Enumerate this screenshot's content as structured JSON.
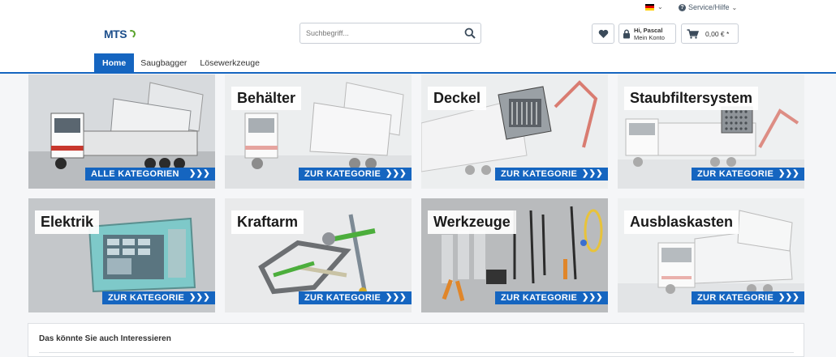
{
  "topbar": {
    "language": {
      "flag_icon": "germany-flag-icon",
      "colors": [
        "#000000",
        "#dd0000",
        "#ffce00"
      ]
    },
    "service_label": "Service/Hilfe"
  },
  "header": {
    "logo_text": "MTS",
    "logo_colors": {
      "text": "#1d4f8c",
      "swoosh": "#5aa32c"
    },
    "search": {
      "placeholder": "Suchbegriff...",
      "value": ""
    },
    "account": {
      "line1": "Hi, Pascal",
      "line2": "Mein Konto"
    },
    "cart": {
      "price": "0,00 € *"
    }
  },
  "nav": {
    "tabs": [
      {
        "label": "Home",
        "active": true
      },
      {
        "label": "Saugbagger",
        "active": false
      },
      {
        "label": "Lösewerkzeuge",
        "active": false
      }
    ]
  },
  "tiles": [
    {
      "title": "",
      "cta": "ALLE KATEGORIEN",
      "image": "truck-photo"
    },
    {
      "title": "Behälter",
      "cta": "ZUR KATEGORIE",
      "image": "truck-container-photo"
    },
    {
      "title": "Deckel",
      "cta": "ZUR KATEGORIE",
      "image": "lid-photo"
    },
    {
      "title": "Staubfiltersystem",
      "cta": "ZUR KATEGORIE",
      "image": "filter-photo"
    },
    {
      "title": "Elektrik",
      "cta": "ZUR KATEGORIE",
      "image": "control-panel-photo"
    },
    {
      "title": "Kraftarm",
      "cta": "ZUR KATEGORIE",
      "image": "arm-diagram"
    },
    {
      "title": "Werkzeuge",
      "cta": "ZUR KATEGORIE",
      "image": "tools-photo"
    },
    {
      "title": "Ausblaskasten",
      "cta": "ZUR KATEGORIE",
      "image": "blowout-box-photo"
    }
  ],
  "recommendations": {
    "title": "Das könnte Sie auch Interessieren"
  },
  "colors": {
    "primary": "#1565c0",
    "cta_arrow": "»"
  },
  "icons": {
    "cta_arrow_text": "❯❯❯"
  }
}
